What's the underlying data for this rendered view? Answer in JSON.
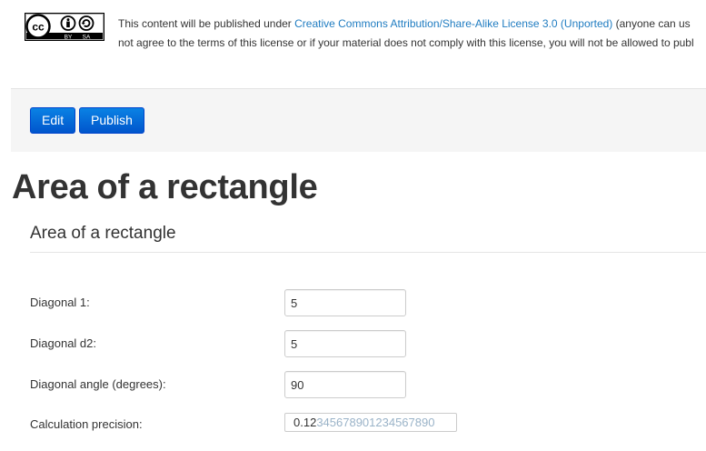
{
  "license": {
    "badge": {
      "cc_text": "cc",
      "by_text": "BY",
      "sa_text": "SA"
    },
    "text_before_link": "This content will be published under ",
    "link_text": "Creative Commons Attribution/Share-Alike License 3.0 (Unported)",
    "text_after_link": " (anyone can us",
    "line2": "not agree to the terms of this license or if your material does not comply with this license, you will not be allowed to publ"
  },
  "toolbar": {
    "edit_label": "Edit",
    "publish_label": "Publish"
  },
  "page_title": "Area of a rectangle",
  "section_title": "Area of a rectangle",
  "form": {
    "diagonal1": {
      "label": "Diagonal 1:",
      "value": "5"
    },
    "diagonal2": {
      "label": "Diagonal d2:",
      "value": "5"
    },
    "angle": {
      "label": "Diagonal angle (degrees):",
      "value": "90"
    },
    "precision": {
      "label": "Calculation precision:",
      "selected_text": "0.12",
      "remaining_text": "345678901234567890"
    }
  },
  "colors": {
    "accent": "#0055cc",
    "link": "#1f7cc1",
    "toolbar_bg": "#f5f5f5"
  }
}
